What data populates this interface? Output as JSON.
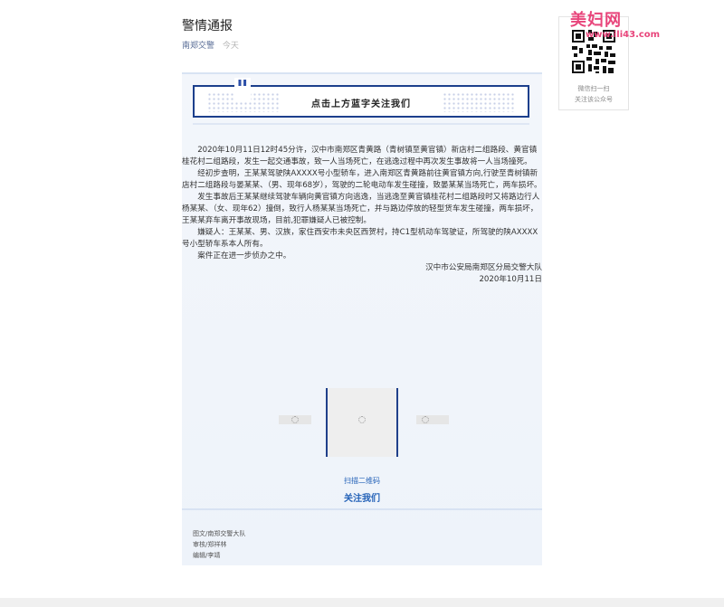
{
  "article": {
    "title": "警情通报",
    "account": "南郑交警",
    "date": "今天",
    "banner_text": "点击上方蓝字关注我们",
    "banner_quote": "\"",
    "paragraphs": [
      "2020年10月11日12时45分许，汉中市南郑区青黄路（青树镇至黄官镇）新店村二组路段、黄官镇桂花村二组路段，发生一起交通事故，致一人当场死亡，在逃逸过程中再次发生事故将一人当场撞死。",
      "经初步查明，王某某驾驶陕AXXXX号小型轿车，进入南郑区青黄路前往黄官镇方向,行驶至青树镇新店村二组路段与晏某某、（男、现年68岁），驾驶的二轮电动车发生碰撞，致晏某某当场死亡，两车损坏。",
      "发生事故后王某某继续驾驶车辆向黄官镇方向逃逸，当逃逸至黄官镇桂花村二组路段时又将路边行人杨某某、（女、现年62）撞倒，致行人杨某某当场死亡，并与路边停放的轻型货车发生碰撞，两车损坏，王某某弃车离开事故现场，目前,犯罪嫌疑人已被控制。",
      "嫌疑人：王某某、男、汉族，家住西安市未央区西贺村，持C1型机动车驾驶证，所驾驶的陕AXXXX号小型轿车系本人所有。",
      "案件正在进一步侦办之中。"
    ],
    "sign_org": "汉中市公安局南郑区分局交警大队",
    "sign_date": "2020年10月11日",
    "scan_small": "扫描二维码",
    "scan_big": "关注我们",
    "credits": [
      "图文/南郑交警大队",
      "审核/郑祥林",
      "编辑/李靖"
    ]
  },
  "sidebar": {
    "line1": "微信扫一扫",
    "line2": "关注该公众号"
  },
  "watermark": {
    "text": "美妇网",
    "url": "www.ili43.com"
  },
  "colors": {
    "accent_blue": "#1c3f8c",
    "link_blue": "#2563b8",
    "watermark_pink": "#e8457b"
  },
  "icons": {
    "loading": "spinner-icon",
    "qr": "qr-code-icon"
  }
}
